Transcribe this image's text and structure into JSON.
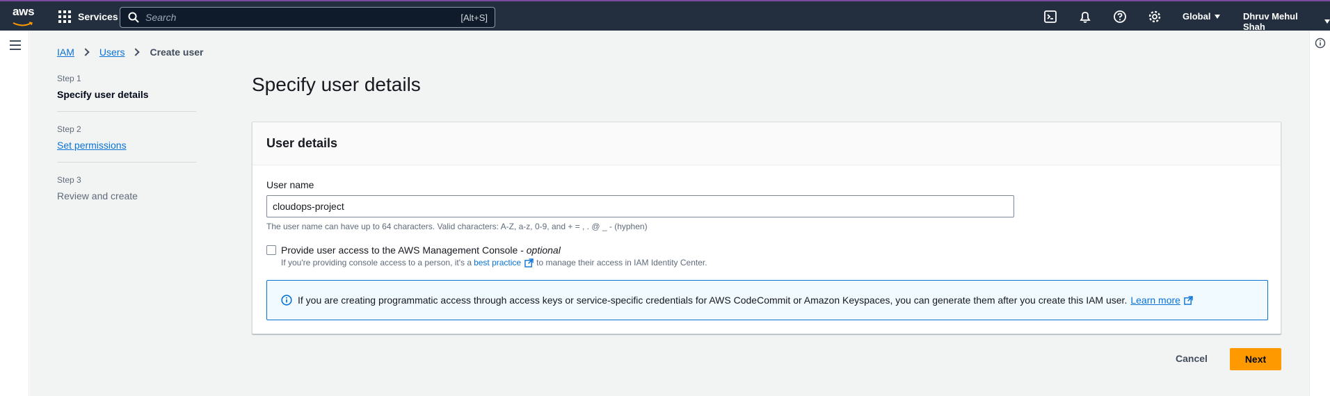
{
  "topbar": {
    "logo": "aws",
    "services_label": "Services",
    "search_placeholder": "Search",
    "search_shortcut": "[Alt+S]",
    "region_label": "Global",
    "user_label": "Dhruv Mehul Shah"
  },
  "breadcrumb": {
    "items": [
      "IAM",
      "Users"
    ],
    "current": "Create user"
  },
  "steps": [
    {
      "number": "Step 1",
      "title": "Specify user details"
    },
    {
      "number": "Step 2",
      "title": "Set permissions"
    },
    {
      "number": "Step 3",
      "title": "Review and create"
    }
  ],
  "page": {
    "title": "Specify user details"
  },
  "card": {
    "header": "User details",
    "username_label": "User name",
    "username_value": "cloudops-project",
    "username_hint": "The user name can have up to 64 characters. Valid characters: A-Z, a-z, 0-9, and + = , . @ _ - (hyphen)",
    "console_access_label": "Provide user access to the AWS Management Console - ",
    "console_access_optional": "optional",
    "console_access_desc_prefix": "If you're providing console access to a person, it's a",
    "console_access_link": "best practice",
    "console_access_desc_suffix": "to manage their access in IAM Identity Center.",
    "alert_text": "If you are creating programmatic access through access keys or service-specific credentials for AWS CodeCommit or Amazon Keyspaces, you can generate them after you create this IAM user.",
    "alert_link": "Learn more"
  },
  "actions": {
    "cancel": "Cancel",
    "next": "Next"
  },
  "colors": {
    "topbar_bg": "#232f3e",
    "link": "#0972d3",
    "primary_button": "#ff9900",
    "alert_border": "#0972d3"
  }
}
